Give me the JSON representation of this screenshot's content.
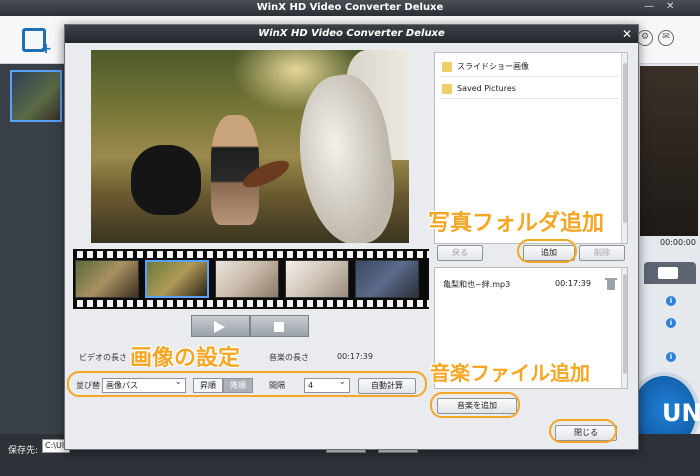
{
  "main_window": {
    "title": "WinX HD Video Converter Deluxe",
    "preview_time": "00:00:00",
    "run_label": "UN",
    "save_label": "保存先:",
    "save_path": "C:\\Ul"
  },
  "dialog": {
    "title": "WinX HD Video Converter Deluxe",
    "close_symbol": "✕",
    "info": {
      "video_length_label": "ビデオの長さ",
      "music_length_label": "音楽の長さ",
      "music_length_value": "00:17:39"
    },
    "controls": {
      "order_label": "並び替",
      "order_value": "画像パス",
      "asc_label": "昇順",
      "desc_label": "降順",
      "interval_label": "間隔",
      "interval_value": "4",
      "auto_calc_label": "自動計算"
    },
    "folders": [
      {
        "name": "スライドショー画像"
      },
      {
        "name": "Saved Pictures"
      }
    ],
    "folder_buttons": {
      "back": "戻る",
      "add": "追加",
      "delete": "削除"
    },
    "music": {
      "items": [
        {
          "name": "亀梨和也~絆.mp3",
          "duration": "00:17:39"
        }
      ],
      "add_label": "音楽を追加"
    },
    "close_label": "閉じる"
  },
  "annotations": {
    "photo_folder": "写真フォルダ追加",
    "image_settings": "画像の設定",
    "music_file": "音楽ファイル追加"
  },
  "colors": {
    "annotation": "#f5a623",
    "selection": "#5aa0ff",
    "accent_blue": "#1f6fb3"
  }
}
